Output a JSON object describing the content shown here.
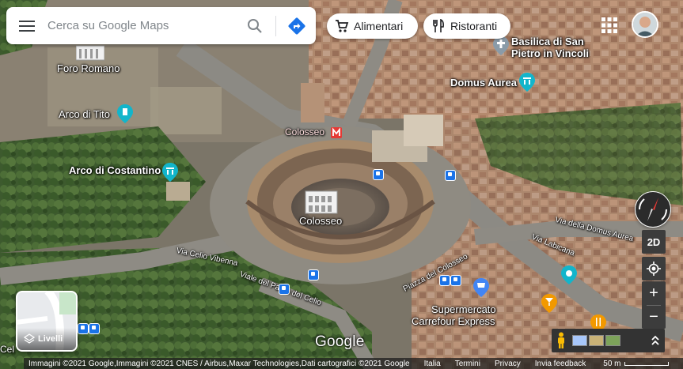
{
  "search": {
    "placeholder": "Cerca su Google Maps"
  },
  "chips": {
    "groceries": "Alimentari",
    "restaurants": "Ristoranti"
  },
  "map_labels": {
    "foro_romano": "Foro Romano",
    "basilica_line1": "Basilica di San",
    "basilica_line2": "Pietro in Vincoli",
    "domus_aurea": "Domus Aurea",
    "arco_di_tito": "Arco di Tito",
    "colosseo_metro": "Colosseo",
    "arco_di_costantino": "Arco di Costantino",
    "colosseo": "Colosseo",
    "supermercato_line1": "Supermercato",
    "supermercato_line2": "Carrefour Express",
    "via_celio_vibenna": "Via Celio Vibenna",
    "viale_parco_celio": "Viale del Parco del Celio",
    "piazza_colosseo": "Piazza del Colosseo",
    "via_labicana": "Via Labicana",
    "via_dorata": "Via della Domus Aurea",
    "cell_fragment": "Cel"
  },
  "controls": {
    "two_d": "2D",
    "zoom_in": "+",
    "zoom_out": "−",
    "layers": "Livelli"
  },
  "branding": {
    "logo": "Google"
  },
  "footer": {
    "attribution": "Immagini ©2021 Google,Immagini ©2021 CNES / Airbus,Maxar Technologies,Dati cartografici ©2021 Google",
    "country": "Italia",
    "terms": "Termini",
    "privacy": "Privacy",
    "feedback": "Invia feedback",
    "scale": "50 m"
  },
  "colors": {
    "accent_blue": "#1a73e8",
    "poi_teal": "#12b5cb",
    "metro_red": "#e53935",
    "food_orange": "#f29900"
  },
  "icons": {
    "menu": "menu-icon",
    "search": "search-icon",
    "directions": "directions-icon",
    "cart": "cart-icon",
    "restaurant": "restaurant-icon",
    "apps": "apps-grid-icon",
    "compass": "compass-icon",
    "locate": "my-location-icon",
    "layers": "layers-icon",
    "pegman": "pegman-icon",
    "expand": "expand-up-icon"
  }
}
